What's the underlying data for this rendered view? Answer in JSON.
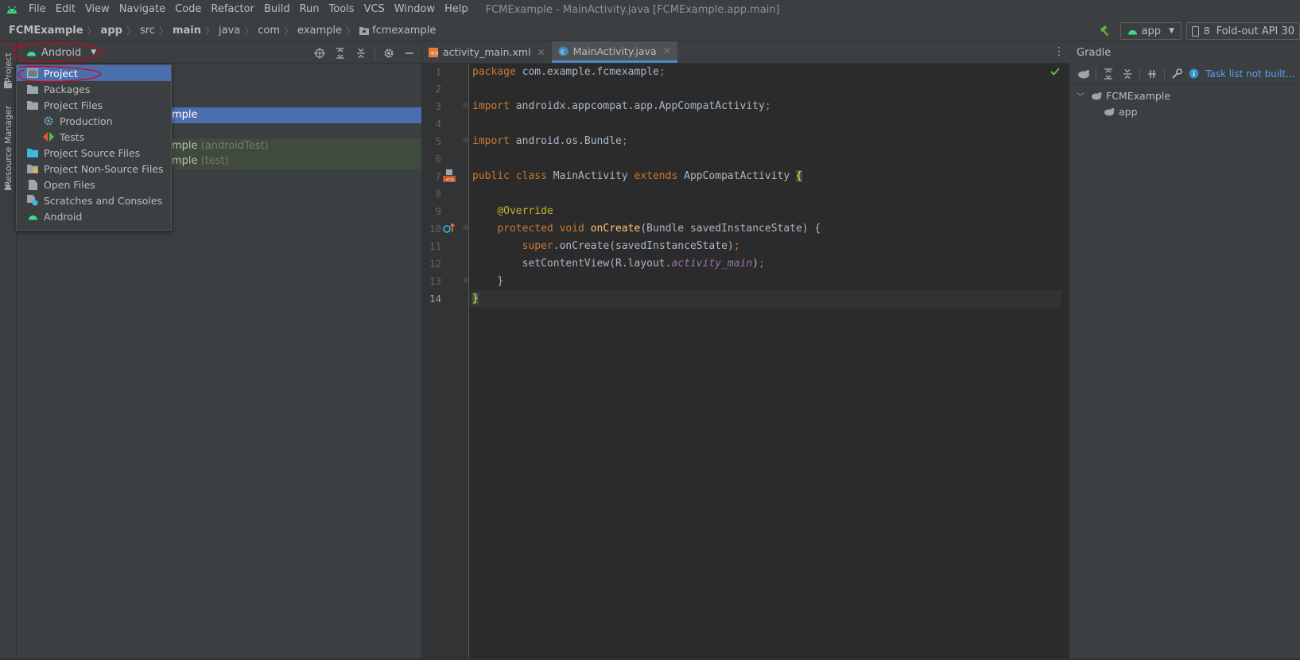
{
  "menubar": {
    "items": [
      "File",
      "Edit",
      "View",
      "Navigate",
      "Code",
      "Refactor",
      "Build",
      "Run",
      "Tools",
      "VCS",
      "Window",
      "Help"
    ],
    "title": "FCMExample - MainActivity.java [FCMExample.app.main]"
  },
  "navbar": {
    "crumbs": [
      "FCMExample",
      "app",
      "src",
      "main",
      "java",
      "com",
      "example",
      "fcmexample"
    ],
    "run_config": "app",
    "device_count": "8",
    "device": "Fold-out API 30"
  },
  "left_strip": {
    "project_tab": "Project",
    "resource_tab": "Resource Manager"
  },
  "project_panel": {
    "view_selector": "Android",
    "rows": [
      {
        "text": "mple",
        "hint": ""
      },
      {
        "text": "mple",
        "hint": "(androidTest)"
      },
      {
        "text": "mple",
        "hint": "(test)"
      }
    ]
  },
  "dropdown": {
    "items": [
      {
        "label": "Project",
        "icon": "project-icon"
      },
      {
        "label": "Packages",
        "icon": "folder-icon"
      },
      {
        "label": "Project Files",
        "icon": "folder-icon"
      },
      {
        "label": "Production",
        "icon": "gear-icon"
      },
      {
        "label": "Tests",
        "icon": "test-icon"
      },
      {
        "label": "Project Source Files",
        "icon": "folder-icon"
      },
      {
        "label": "Project Non-Source Files",
        "icon": "folder-icon"
      },
      {
        "label": "Open Files",
        "icon": "file-icon"
      },
      {
        "label": "Scratches and Consoles",
        "icon": "scratch-icon"
      },
      {
        "label": "Android",
        "icon": "android-icon"
      }
    ]
  },
  "editor": {
    "tabs": [
      {
        "label": "activity_main.xml",
        "active": false
      },
      {
        "label": "MainActivity.java",
        "active": true
      }
    ],
    "line_numbers": [
      "1",
      "2",
      "3",
      "4",
      "5",
      "6",
      "7",
      "8",
      "9",
      "10",
      "11",
      "12",
      "13",
      "14"
    ],
    "code": {
      "l1_kw": "package",
      "l1_rest": " com.example.fcmexample",
      "l3_kw": "import",
      "l3_rest": " androidx.appcompat.app.AppCompatActivity",
      "l5_kw": "import",
      "l5_rest": " android.os.Bundle",
      "semi": ";",
      "l7_kw1": "public class",
      "l7_name": " MainActivity ",
      "l7_kw2": "extends",
      "l7_rest": " AppCompatActivity ",
      "l7_brace": "{",
      "l9_ann": "@Override",
      "l10_kw": "protected void",
      "l10_fn": " onCreate",
      "l10_rest": "(Bundle savedInstanceState) {",
      "l11_kw": "super",
      "l11_rest": ".onCreate(savedInstanceState)",
      "l12_a": "setContentView(R.layout.",
      "l12_it": "activity_main",
      "l12_b": ")",
      "l13": "}",
      "l14": "}"
    }
  },
  "gradle": {
    "title": "Gradle",
    "task_link": "Task list not built...",
    "tree": [
      "FCMExample",
      "app"
    ]
  },
  "colors": {
    "selection": "#4b6eaf",
    "android_green": "#3ddc84",
    "keyword": "#cc7832",
    "annotation": "#bbb529",
    "function": "#ffc66d"
  }
}
